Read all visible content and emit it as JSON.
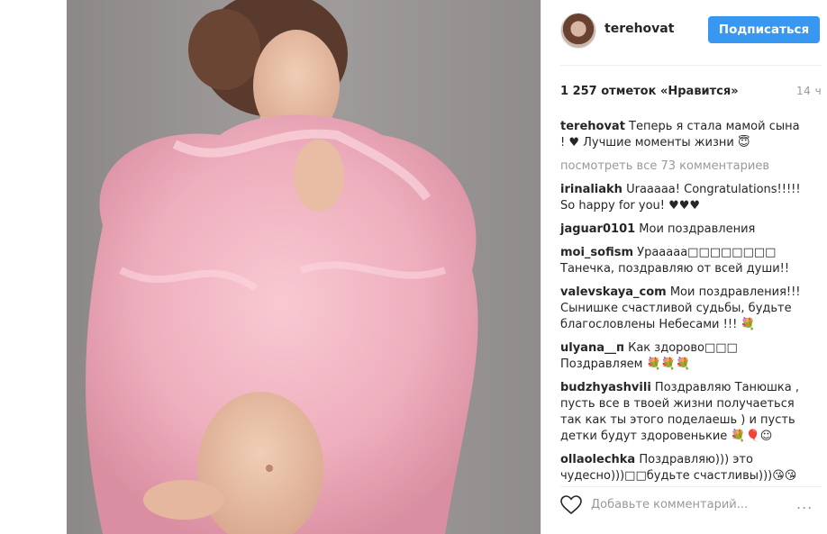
{
  "post": {
    "username": "terehovat",
    "follow_label": "Подписаться",
    "likes": "1 257 отметок «Нравится»",
    "time": "14 ч"
  },
  "comments": [
    {
      "user": "terehovat",
      "text": "Теперь я стала мамой сына ! ♥ Лучшие моменты жизни 😇"
    },
    {
      "user": "irinaliakh",
      "text": "Urааааа! Congratulations!!!!! So happy for you! ♥♥♥"
    },
    {
      "user": "jaguar0101",
      "text": "Мои поздравления"
    },
    {
      "user": "moi_sofism",
      "text": "Урааааа□□□□□□□□ Танечка, поздравляю от всей души!!"
    },
    {
      "user": "valevskaya_com",
      "text": "Мои поздравления!!! Сынишке счастливой судьбы, будьте благословлены Небесами !!! 💐"
    },
    {
      "user": "ulyana__п",
      "text": "Как здорово□□□ Поздравляем 💐💐💐"
    },
    {
      "user": "budzhyashvili",
      "text": "Поздравляю Танюшка , пусть все в твоей жизни получаеться так как ты этого поделаешь ) и пусть детки будут здоровенькие 💐🎈☺"
    },
    {
      "user": "ollaolechka",
      "text": "Поздравляю))) это чудесно)))□□будьте счастливы)))😘😘"
    }
  ],
  "view_all": "посмотреть все 73 комментариев",
  "add_comment_placeholder": "Добавьте комментарий...",
  "more_label": "...",
  "icons": {
    "like": "heart-icon",
    "avatar": "avatar"
  },
  "colors": {
    "accent": "#3897f0",
    "muted": "#999999",
    "fur": "#f2b9c4"
  }
}
